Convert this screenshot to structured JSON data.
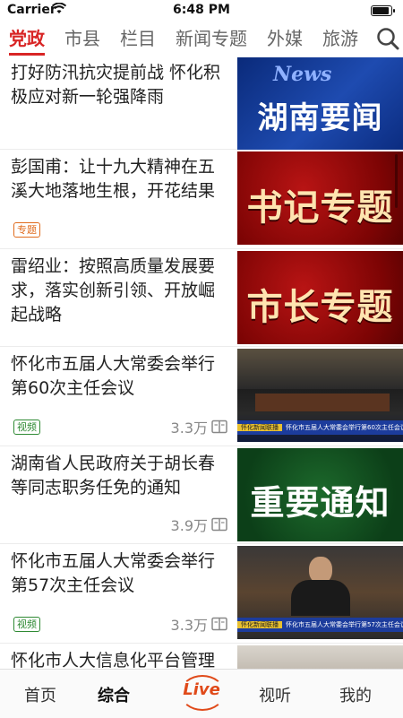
{
  "status_bar": {
    "carrier": "Carrier",
    "time": "6:48 PM"
  },
  "tabs": [
    {
      "label": "党政",
      "active": true
    },
    {
      "label": "市县"
    },
    {
      "label": "栏目"
    },
    {
      "label": "新闻专题"
    },
    {
      "label": "外媒"
    },
    {
      "label": "旅游"
    }
  ],
  "feed": [
    {
      "title": "打好防汛抗灾提前战 怀化积极应对新一轮强降雨",
      "thumb_text": "湖南要闻",
      "thumb_sub": "News"
    },
    {
      "title": "彭国甫：让十九大精神在五溪大地落地生根，开花结果",
      "tag": "专题",
      "thumb_text": "书记专题"
    },
    {
      "title": "雷绍业：按照高质量发展要求，落实创新引领、开放崛起战略",
      "thumb_text": "市长专题"
    },
    {
      "title": "怀化市五届人大常委会举行第60次主任会议",
      "tag": "视频",
      "views": "3.3万",
      "caption_brand": "怀化新闻联播",
      "caption": "怀化市五届人大常委会举行第60次主任会议"
    },
    {
      "title": "湖南省人民政府关于胡长春等同志职务任免的通知",
      "views": "3.9万",
      "thumb_text": "重要通知"
    },
    {
      "title": "怀化市五届人大常委会举行第57次主任会议",
      "tag": "视频",
      "views": "3.3万",
      "caption_brand": "怀化新闻联播",
      "caption": "怀化市五届人大常委会举行第57次主任会议"
    },
    {
      "title": "怀化市人大信息化平台管理"
    }
  ],
  "bottom_nav": {
    "home": "首页",
    "general": "综合",
    "live": "Live",
    "watch": "视听",
    "mine": "我的"
  },
  "colors": {
    "accent": "#d82525",
    "tag_orange": "#e06b1d",
    "tag_green": "#2f8a34"
  }
}
